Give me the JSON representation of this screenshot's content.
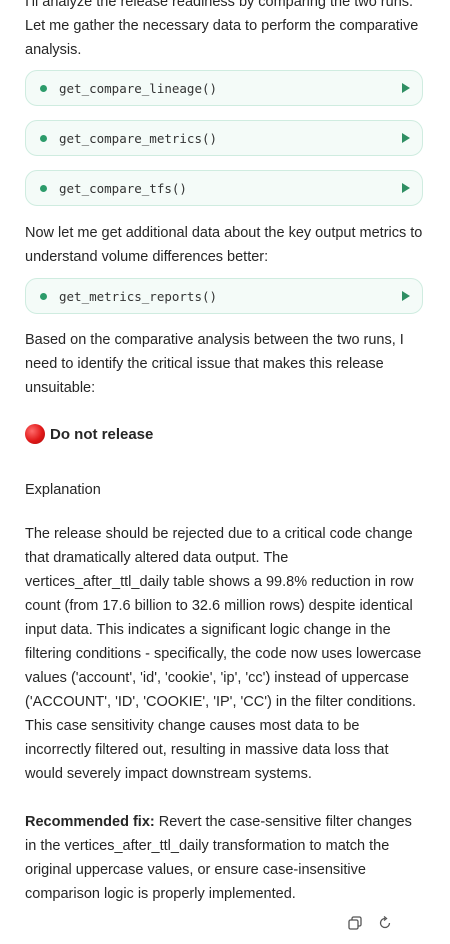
{
  "intro_text": "I'll analyze the release readiness by comparing the two runs. Let me gather the necessary data to perform the comparative analysis.",
  "tools": [
    {
      "name": "get_compare_lineage()"
    },
    {
      "name": "get_compare_metrics()"
    },
    {
      "name": "get_compare_tfs()"
    },
    {
      "name": "get_metrics_reports()"
    }
  ],
  "mid_text": "Now let me get additional data about the key output metrics to understand volume differences better:",
  "analysis_text": "Based on the comparative analysis between the two runs, I need to identify the critical issue that makes this release unsuitable:",
  "verdict": "Do not release",
  "explanation_heading": "Explanation",
  "explanation_text": "The release should be rejected due to a critical code change that dramatically altered data output. The vertices_after_ttl_daily table shows a 99.8% reduction in row count (from 17.6 billion to 32.6 million rows) despite identical input data. This indicates a significant logic change in the filtering conditions - specifically, the code now uses lowercase values ('account', 'id', 'cookie', 'ip', 'cc') instead of uppercase ('ACCOUNT', 'ID', 'COOKIE', 'IP', 'CC') in the filter conditions. This case sensitivity change causes most data to be incorrectly filtered out, resulting in massive data loss that would severely impact downstream systems.",
  "fix_label": "Recommended fix:",
  "fix_text": " Revert the case-sensitive filter changes in the vertices_after_ttl_daily transformation to match the original uppercase values, or ensure case-insensitive comparison logic is properly implemented.",
  "colors": {
    "accent": "#2c9b6a",
    "verdict": "#e01818"
  },
  "icons": [
    "copy-icon",
    "refresh-icon"
  ]
}
